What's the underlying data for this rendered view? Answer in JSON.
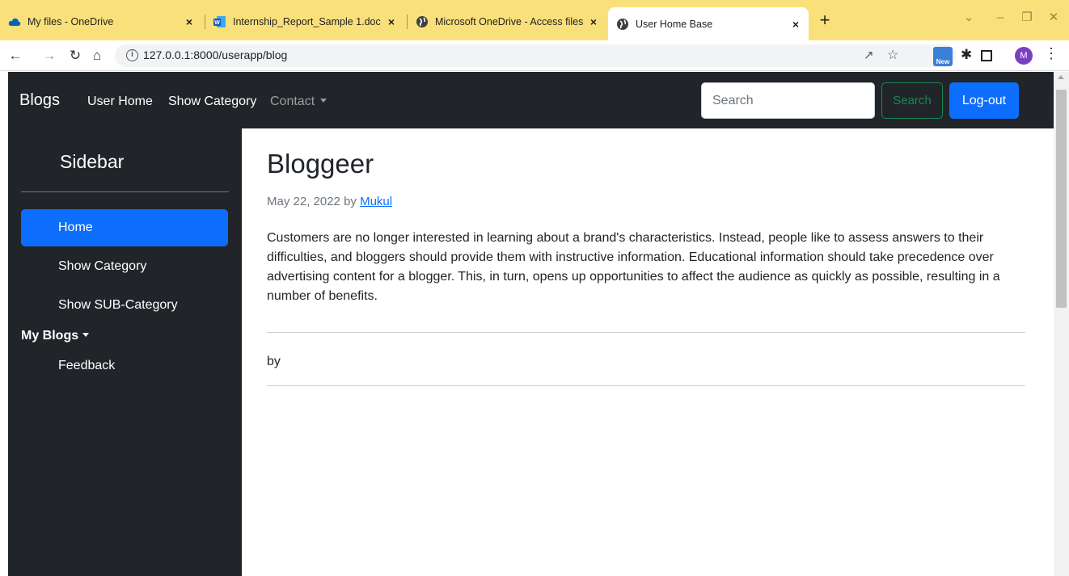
{
  "browser": {
    "tabs": [
      {
        "title": "My files - OneDrive",
        "icon": "onedrive-icon",
        "active": false
      },
      {
        "title": "Internship_Report_Sample 1.doc",
        "icon": "word-icon",
        "active": false
      },
      {
        "title": "Microsoft OneDrive - Access files",
        "icon": "globe-icon",
        "active": false
      },
      {
        "title": "User Home Base",
        "icon": "globe-icon",
        "active": true
      }
    ],
    "tab_close_glyph": "×",
    "new_tab_glyph": "+",
    "url": "127.0.0.1:8000/userapp/blog",
    "profile_initial": "M",
    "extension_new_label": "New"
  },
  "navbar": {
    "brand": "Blogs",
    "links": [
      "User Home",
      "Show Category"
    ],
    "dropdown_label": "Contact",
    "search_placeholder": "Search",
    "search_button": "Search",
    "logout_button": "Log-out"
  },
  "sidebar": {
    "title": "Sidebar",
    "items": [
      {
        "label": "Home",
        "active": true
      },
      {
        "label": "Show Category",
        "active": false
      },
      {
        "label": "Show SUB-Category",
        "active": false
      }
    ],
    "dropdown_label": "My Blogs",
    "sub_items": [
      "Feedback"
    ]
  },
  "post": {
    "title": "Bloggeer",
    "date": "May 22, 2022",
    "by_word": "by",
    "author": "Mukul",
    "body": "Customers are no longer interested in learning about a brand's characteristics. Instead, people like to assess answers to their difficulties, and bloggers should provide them with instructive information. Educational information should take precedence over advertising content for a blogger. This, in turn, opens up opportunities to affect the audience as quickly as possible, resulting in a number of benefits.",
    "second_by": "by"
  },
  "colors": {
    "dark": "#212529",
    "primary": "#0d6efd",
    "success": "#198754",
    "tabstrip": "#f9e07a"
  }
}
